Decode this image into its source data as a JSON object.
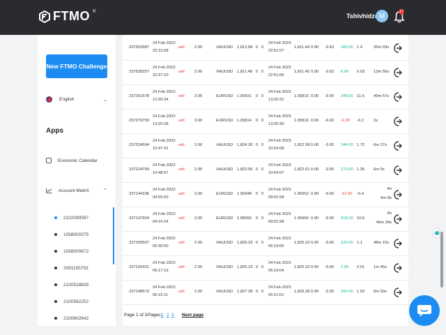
{
  "header": {
    "logo_text": "FTMO",
    "logo_mark": "®",
    "user_name": "Tshivhidzo",
    "avatar_initial": "M",
    "notification_count": "17"
  },
  "sidebar": {
    "new_challenge_label": "New FTMO Challenge",
    "language_label": "English",
    "apps_title": "Apps",
    "economic_calendar_label": "Economic Calendar",
    "account_metrix_label": "Account MetriX",
    "accounts": [
      "2102090597",
      "1058000375",
      "1058000672",
      "2091155753",
      "2100528839",
      "2100562252",
      "2100602642"
    ]
  },
  "trades": [
    {
      "ticket": "237523587",
      "open_date": "24 Feb 2023",
      "open_time": "22:15:08",
      "type": "sell",
      "volume": "2.00",
      "symbol": "XAUUSD",
      "open_price": "1,812.84",
      "sl": "0",
      "tp": "0",
      "close_date": "24 Feb 2023",
      "close_time": "22:51:07",
      "close_price": "1,811.44",
      "swap": "0.00",
      "commission": "-3.63",
      "profit": "280.00",
      "pips": "1.4",
      "duration_1": "35m 59s",
      "duration_2": "",
      "profit_positive": true
    },
    {
      "ticket": "237529257",
      "open_date": "24 Feb 2023",
      "open_time": "22:37:10",
      "type": "sell",
      "volume": "2.00",
      "symbol": "XAUUSD",
      "open_price": "1,811.48",
      "sl": "0",
      "tp": "0",
      "close_date": "24 Feb 2023",
      "close_time": "22:51:06",
      "close_price": "1,811.45",
      "swap": "0.00",
      "commission": "-3.62",
      "profit": "6.00",
      "pips": "0.03",
      "duration_1": "13m 56s",
      "duration_2": "",
      "profit_positive": true
    },
    {
      "ticket": "237261578",
      "open_date": "24 Feb 2023",
      "open_time": "12:30:34",
      "type": "sell",
      "volume": "3.00",
      "symbol": "EURUSD",
      "open_price": "1.05931",
      "sl": "0",
      "tp": "0",
      "close_date": "24 Feb 2023",
      "close_time": "13:20:31",
      "close_price": "1.05815",
      "swap": "0.00",
      "commission": "-9.00",
      "profit": "348.00",
      "pips": "11.6",
      "duration_1": "49m 57s",
      "duration_2": "",
      "profit_positive": true
    },
    {
      "ticket": "237279759",
      "open_date": "24 Feb 2023",
      "open_time": "13:20:28",
      "type": "sell",
      "volume": "3.00",
      "symbol": "EURUSD",
      "open_price": "1.05814",
      "sl": "0",
      "tp": "0",
      "close_date": "24 Feb 2023",
      "close_time": "13:20:30",
      "close_price": "1.05816",
      "swap": "0.00",
      "commission": "-9.00",
      "profit": "-6.00",
      "pips": "-0.2",
      "duration_1": "2s",
      "duration_2": "",
      "profit_positive": false
    },
    {
      "ticket": "237224594",
      "open_date": "24 Feb 2023",
      "open_time": "10:47:41",
      "type": "sell",
      "volume": "2.00",
      "symbol": "XAUUSD",
      "open_price": "1,824.30",
      "sl": "0",
      "tp": "0",
      "close_date": "24 Feb 2023",
      "close_time": "10:54:08",
      "close_price": "1,822.58",
      "swap": "0.00",
      "commission": "-3.65",
      "profit": "344.00",
      "pips": "1.72",
      "duration_1": "6m 27s",
      "duration_2": "",
      "profit_positive": true
    },
    {
      "ticket": "237224759",
      "open_date": "24 Feb 2023",
      "open_time": "10:48:07",
      "type": "sell",
      "volume": "2.00",
      "symbol": "XAUUSD",
      "open_price": "1,823.96",
      "sl": "0",
      "tp": "0",
      "close_date": "24 Feb 2023",
      "close_time": "10:54:07",
      "close_price": "1,822.61",
      "swap": "0.00",
      "commission": "-3.65",
      "profit": "270.00",
      "pips": "1.35",
      "duration_1": "6m 0s",
      "duration_2": "",
      "profit_positive": true
    },
    {
      "ticket": "237144236",
      "open_date": "24 Feb 2023",
      "open_time": "04:55:50",
      "type": "sell",
      "volume": "3.00",
      "symbol": "EURUSD",
      "open_price": "1.05948",
      "sl": "0",
      "tp": "0",
      "close_date": "24 Feb 2023",
      "close_time": "09:01:58",
      "close_price": "1.05952",
      "swap": "0.00",
      "commission": "-9.00",
      "profit": "-12.00",
      "pips": "-0.4",
      "duration_1": "4h",
      "duration_2": "6m 8s",
      "profit_positive": false
    },
    {
      "ticket": "237137924",
      "open_date": "24 Feb 2023",
      "open_time": "04:15:24",
      "type": "sell",
      "volume": "3.00",
      "symbol": "EURUSD",
      "open_price": "1.06056",
      "sl": "0",
      "tp": "0",
      "close_date": "24 Feb 2023",
      "close_time": "09:01:58",
      "close_price": "1.05950",
      "swap": "0.00",
      "commission": "-9.00",
      "profit": "318.00",
      "pips": "10.6",
      "duration_1": "4h",
      "duration_2": "46m 34s",
      "profit_positive": true
    },
    {
      "ticket": "237150507",
      "open_date": "24 Feb 2023",
      "open_time": "05:30:50",
      "type": "sell",
      "volume": "2.00",
      "symbol": "XAUUSD",
      "open_price": "1,826.32",
      "sl": "0",
      "tp": "0",
      "close_date": "24 Feb 2023",
      "close_time": "06:19:05",
      "close_price": "1,825.22",
      "swap": "0.00",
      "commission": "-3.65",
      "profit": "220.00",
      "pips": "1.1",
      "duration_1": "48m 15s",
      "duration_2": "",
      "profit_positive": true
    },
    {
      "ticket": "237155421",
      "open_date": "24 Feb 2023",
      "open_time": "06:17:19",
      "type": "sell",
      "volume": "2.00",
      "symbol": "XAUUSD",
      "open_price": "1,825.23",
      "sl": "0",
      "tp": "0",
      "close_date": "24 Feb 2023",
      "close_time": "06:19:04",
      "close_price": "1,825.22",
      "swap": "0.00",
      "commission": "-3.65",
      "profit": "2.00",
      "pips": "0.01",
      "duration_1": "1m 45s",
      "duration_2": "",
      "profit_positive": true
    },
    {
      "ticket": "237148573",
      "open_date": "24 Feb 2023",
      "open_time": "05:15:11",
      "type": "sell",
      "volume": "2.00",
      "symbol": "XAUUSD",
      "open_price": "1,827.38",
      "sl": "0",
      "tp": "0",
      "close_date": "24 Feb 2023",
      "close_time": "05:21:01",
      "close_price": "1,826.36",
      "swap": "0.00",
      "commission": "-3.65",
      "profit": "204.00",
      "pips": "1.02",
      "duration_1": "5m 50s",
      "duration_2": "",
      "profit_positive": true
    }
  ],
  "pagination": {
    "page_info": "Page 1 of 3",
    "pages_label": "Pages:",
    "pages": [
      "1",
      "2",
      "3"
    ],
    "next_label": "Next page"
  },
  "colors": {
    "accent": "#1c8cf2",
    "profit": "#16b39a",
    "loss": "#e53935",
    "topbar": "#2a2b2e"
  },
  "icons": {
    "logo": "ftmo-logo-icon",
    "bell": "bell-icon",
    "share": "share-arrow-icon",
    "chat": "chat-bubble-icon"
  }
}
